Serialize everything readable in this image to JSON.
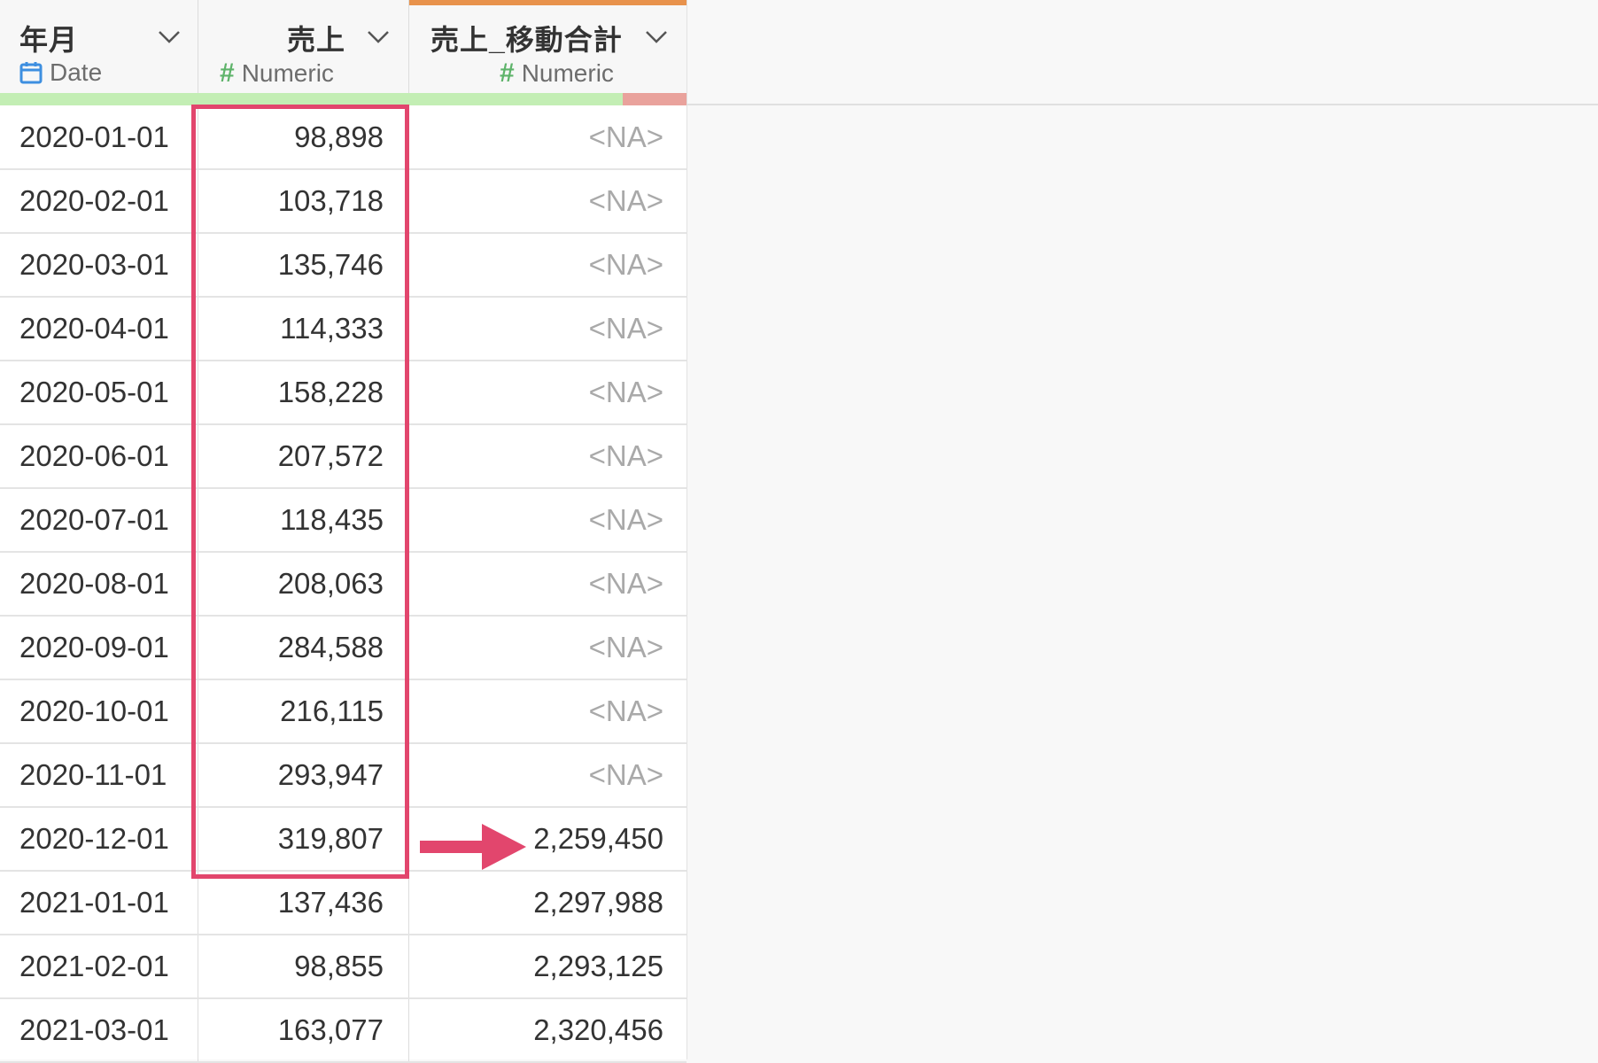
{
  "columns": [
    {
      "name": "年月",
      "type_label": "Date",
      "type_icon": "calendar-icon"
    },
    {
      "name": "売上",
      "type_label": "Numeric",
      "type_icon": "hash-icon"
    },
    {
      "name": "売上_移動合計",
      "type_label": "Numeric",
      "type_icon": "hash-icon"
    }
  ],
  "colors": {
    "accent_active": "#e8924c",
    "quality_ok": "#c3eeb4",
    "quality_missing": "#e9a29c",
    "highlight": "#e2466d"
  },
  "rows": [
    {
      "date": "2020-01-01",
      "sales": "98,898",
      "moving": "<NA>"
    },
    {
      "date": "2020-02-01",
      "sales": "103,718",
      "moving": "<NA>"
    },
    {
      "date": "2020-03-01",
      "sales": "135,746",
      "moving": "<NA>"
    },
    {
      "date": "2020-04-01",
      "sales": "114,333",
      "moving": "<NA>"
    },
    {
      "date": "2020-05-01",
      "sales": "158,228",
      "moving": "<NA>"
    },
    {
      "date": "2020-06-01",
      "sales": "207,572",
      "moving": "<NA>"
    },
    {
      "date": "2020-07-01",
      "sales": "118,435",
      "moving": "<NA>"
    },
    {
      "date": "2020-08-01",
      "sales": "208,063",
      "moving": "<NA>"
    },
    {
      "date": "2020-09-01",
      "sales": "284,588",
      "moving": "<NA>"
    },
    {
      "date": "2020-10-01",
      "sales": "216,115",
      "moving": "<NA>"
    },
    {
      "date": "2020-11-01",
      "sales": "293,947",
      "moving": "<NA>"
    },
    {
      "date": "2020-12-01",
      "sales": "319,807",
      "moving": "2,259,450"
    },
    {
      "date": "2021-01-01",
      "sales": "137,436",
      "moving": "2,297,988"
    },
    {
      "date": "2021-02-01",
      "sales": "98,855",
      "moving": "2,293,125"
    },
    {
      "date": "2021-03-01",
      "sales": "163,077",
      "moving": "2,320,456"
    }
  ]
}
